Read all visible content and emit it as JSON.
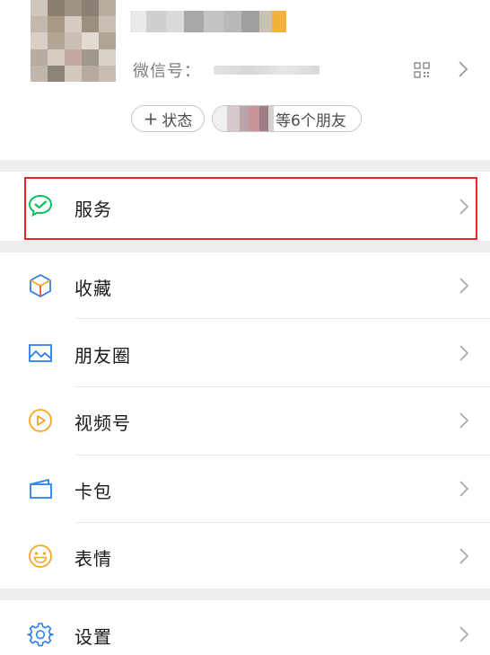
{
  "profile": {
    "wechat_id_label": "微信号：",
    "status_label": "状态",
    "status_plus": "+",
    "friends_text": "等6个朋友"
  },
  "menu": {
    "services": "服务",
    "favorites": "收藏",
    "moments": "朋友圈",
    "channels": "视频号",
    "cards": "卡包",
    "stickers": "表情",
    "settings": "设置"
  },
  "icons": {
    "services": "wechat-pay-icon",
    "favorites": "cube-icon",
    "moments": "image-icon",
    "channels": "play-icon",
    "cards": "wallet-card-icon",
    "stickers": "smile-icon",
    "settings": "gear-icon",
    "qr": "qr-code-icon",
    "chevron": "chevron-right-icon"
  },
  "colors": {
    "services_green": "#07c160",
    "favorites_blue": "#2b7ff0",
    "favorites_orange": "#f5a623",
    "moments_blue": "#2b7ff0",
    "channels_orange": "#f5a623",
    "cards_blue": "#2b7ff0",
    "stickers_orange": "#f5a623",
    "settings_blue": "#2b7ff0",
    "highlight_red": "#e8212a",
    "separator_gray": "#ededed"
  }
}
